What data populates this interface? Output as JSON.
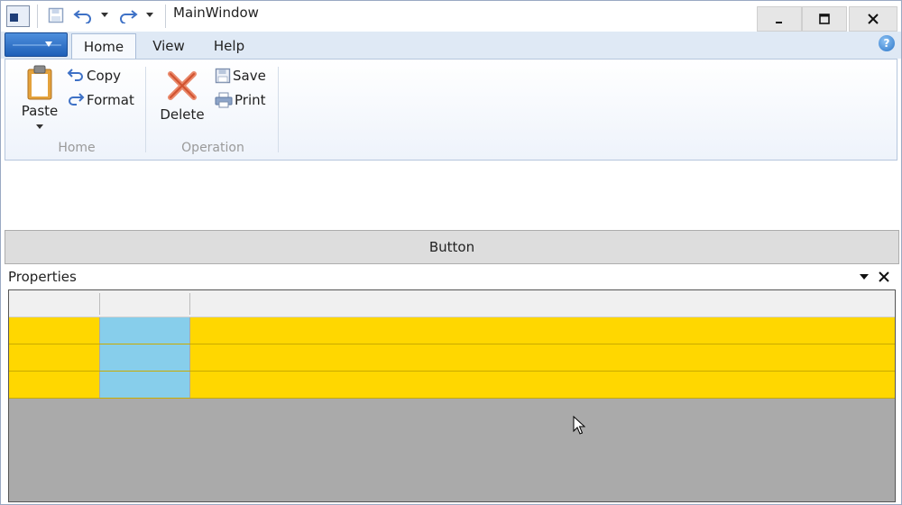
{
  "window": {
    "title": "MainWindow",
    "controls": {
      "minimize": "minimize",
      "maximize": "maximize",
      "close": "close"
    }
  },
  "quick_access": [
    "save-icon",
    "undo-icon",
    "undo-dropdown",
    "redo-icon",
    "customize-dropdown"
  ],
  "ribbon": {
    "tabs": [
      {
        "label": "Home",
        "active": true
      },
      {
        "label": "View",
        "active": false
      },
      {
        "label": "Help",
        "active": false
      }
    ],
    "groups": [
      {
        "label": "Home",
        "buttons": [
          {
            "label": "Paste",
            "icon": "clipboard-icon",
            "size": "large",
            "has_dropdown": true
          },
          {
            "label": "Copy",
            "icon": "undo-arrow-icon",
            "size": "small"
          },
          {
            "label": "Format",
            "icon": "redo-arrow-icon",
            "size": "small"
          }
        ]
      },
      {
        "label": "Operation",
        "buttons": [
          {
            "label": "Delete",
            "icon": "delete-x-icon",
            "size": "large"
          },
          {
            "label": "Save",
            "icon": "floppy-icon",
            "size": "small"
          },
          {
            "label": "Print",
            "icon": "printer-icon",
            "size": "small"
          }
        ]
      }
    ]
  },
  "main_button": {
    "label": "Button"
  },
  "properties_panel": {
    "title": "Properties",
    "grid": {
      "columns": [
        "",
        "",
        ""
      ],
      "rows": [
        [
          "",
          "",
          ""
        ],
        [
          "",
          "",
          ""
        ],
        [
          "",
          "",
          ""
        ]
      ],
      "colors": {
        "row": "#ffd700",
        "highlight_column": "#87ceeb",
        "empty_area": "#aaaaaa"
      }
    }
  }
}
